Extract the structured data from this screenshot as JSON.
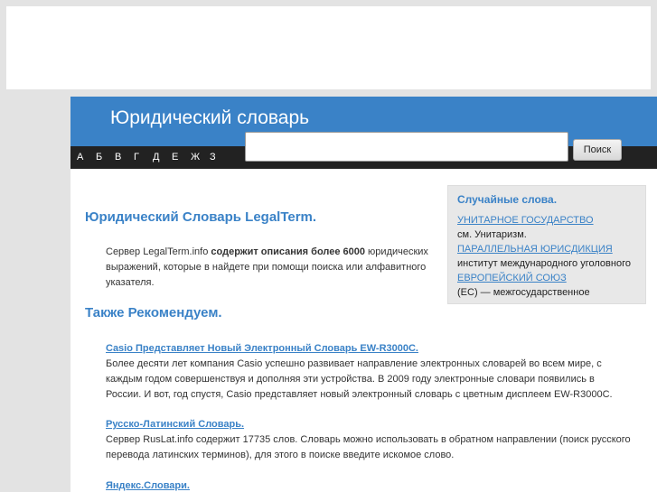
{
  "header": {
    "title": "Юридический словарь"
  },
  "nav": {
    "letters": [
      "А",
      "Б",
      "В",
      "Г",
      "Д",
      "Е",
      "Ж",
      "З"
    ]
  },
  "search": {
    "value": "",
    "button": "Поиск"
  },
  "main": {
    "heading": "Юридический Словарь LegalTerm.",
    "intro_pre": "Сервер LegalTerm.info ",
    "intro_bold": "содержит описания более 6000",
    "intro_post": " юридических выражений, которые в найдете при помощи поиска или алфавитного указателя.",
    "rec_heading": "Также Рекомендуем.",
    "recs": [
      {
        "title": "Casio Представляет Новый Электронный Словарь EW-R3000C.",
        "text": "Более десяти лет компания Casio успешно развивает направление электронных словарей во всем мире, с каждым годом совершенствуя и дополняя эти устройства. В 2009 году электронные словари появились в России. И вот, год спустя, Casio представляет новый электронный словарь с цветным дисплеем EW-R3000C."
      },
      {
        "title": "Русско-Латинский Словарь.",
        "text": "Сервер RusLat.info содержит 17735 слов. Словарь можно использовать в обратном направлении (поиск русского перевода латинских терминов), для этого в поиске введите искомое слово."
      },
      {
        "title": "Яндекс.Словари."
      }
    ]
  },
  "sidebar": {
    "title": "Случайные слова.",
    "items": [
      {
        "term": "УНИТАРНОЕ ГОСУДАРСТВО",
        "desc": "см. Унитаризм."
      },
      {
        "term": "ПАРАЛЛЕЛЬНАЯ ЮРИСДИКЦИЯ",
        "desc": "институт международного уголовного"
      },
      {
        "term": "ЕВРОПЕЙСКИЙ СОЮЗ",
        "desc": "(ЕС) — межгосударственное"
      }
    ]
  }
}
